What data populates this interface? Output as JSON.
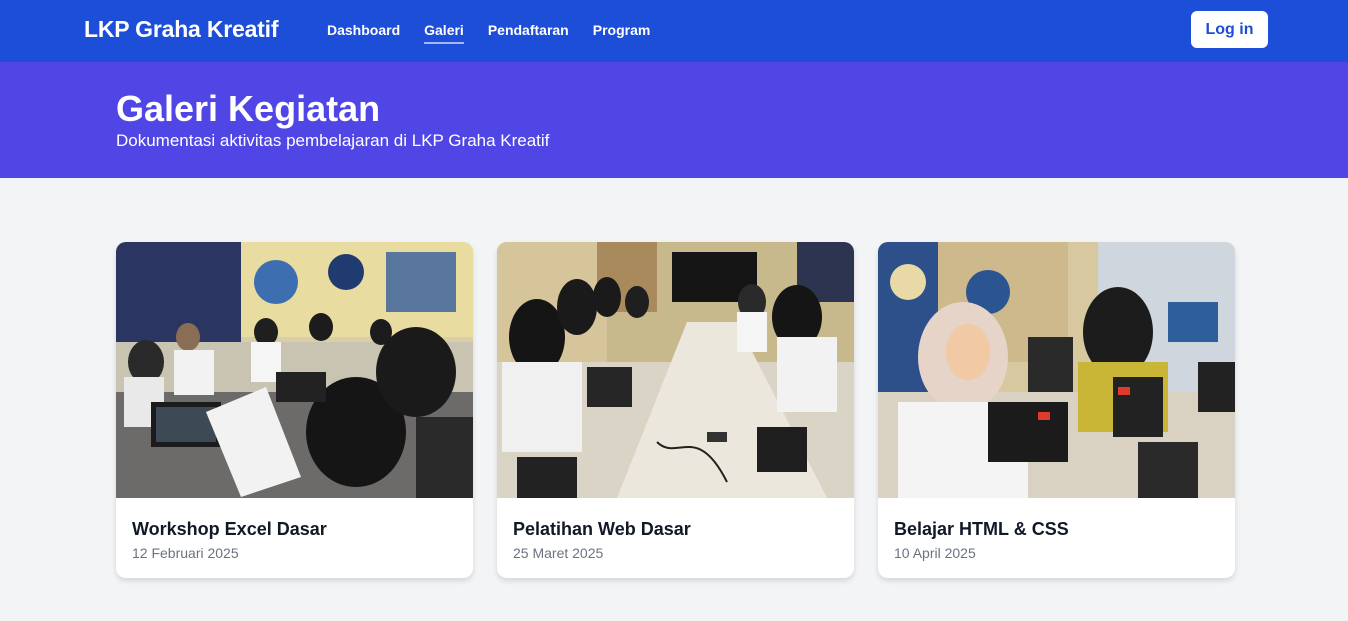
{
  "navbar": {
    "brand": "LKP Graha Kreatif",
    "links": [
      {
        "label": "Dashboard",
        "active": false
      },
      {
        "label": "Galeri",
        "active": true
      },
      {
        "label": "Pendaftaran",
        "active": false
      },
      {
        "label": "Program",
        "active": false
      }
    ],
    "login_label": "Log in"
  },
  "hero": {
    "title": "Galeri Kegiatan",
    "subtitle": "Dokumentasi aktivitas pembelajaran di LKP Graha Kreatif"
  },
  "gallery": [
    {
      "title": "Workshop Excel Dasar",
      "date": "12 Februari 2025",
      "image": "classroom-photo"
    },
    {
      "title": "Pelatihan Web Dasar",
      "date": "25 Maret 2025",
      "image": "classroom-photo"
    },
    {
      "title": "Belajar HTML & CSS",
      "date": "10 April 2025",
      "image": "classroom-photo"
    }
  ],
  "colors": {
    "navbar": "#1d4ed8",
    "hero": "#4f46e5",
    "background": "#f3f4f6"
  }
}
